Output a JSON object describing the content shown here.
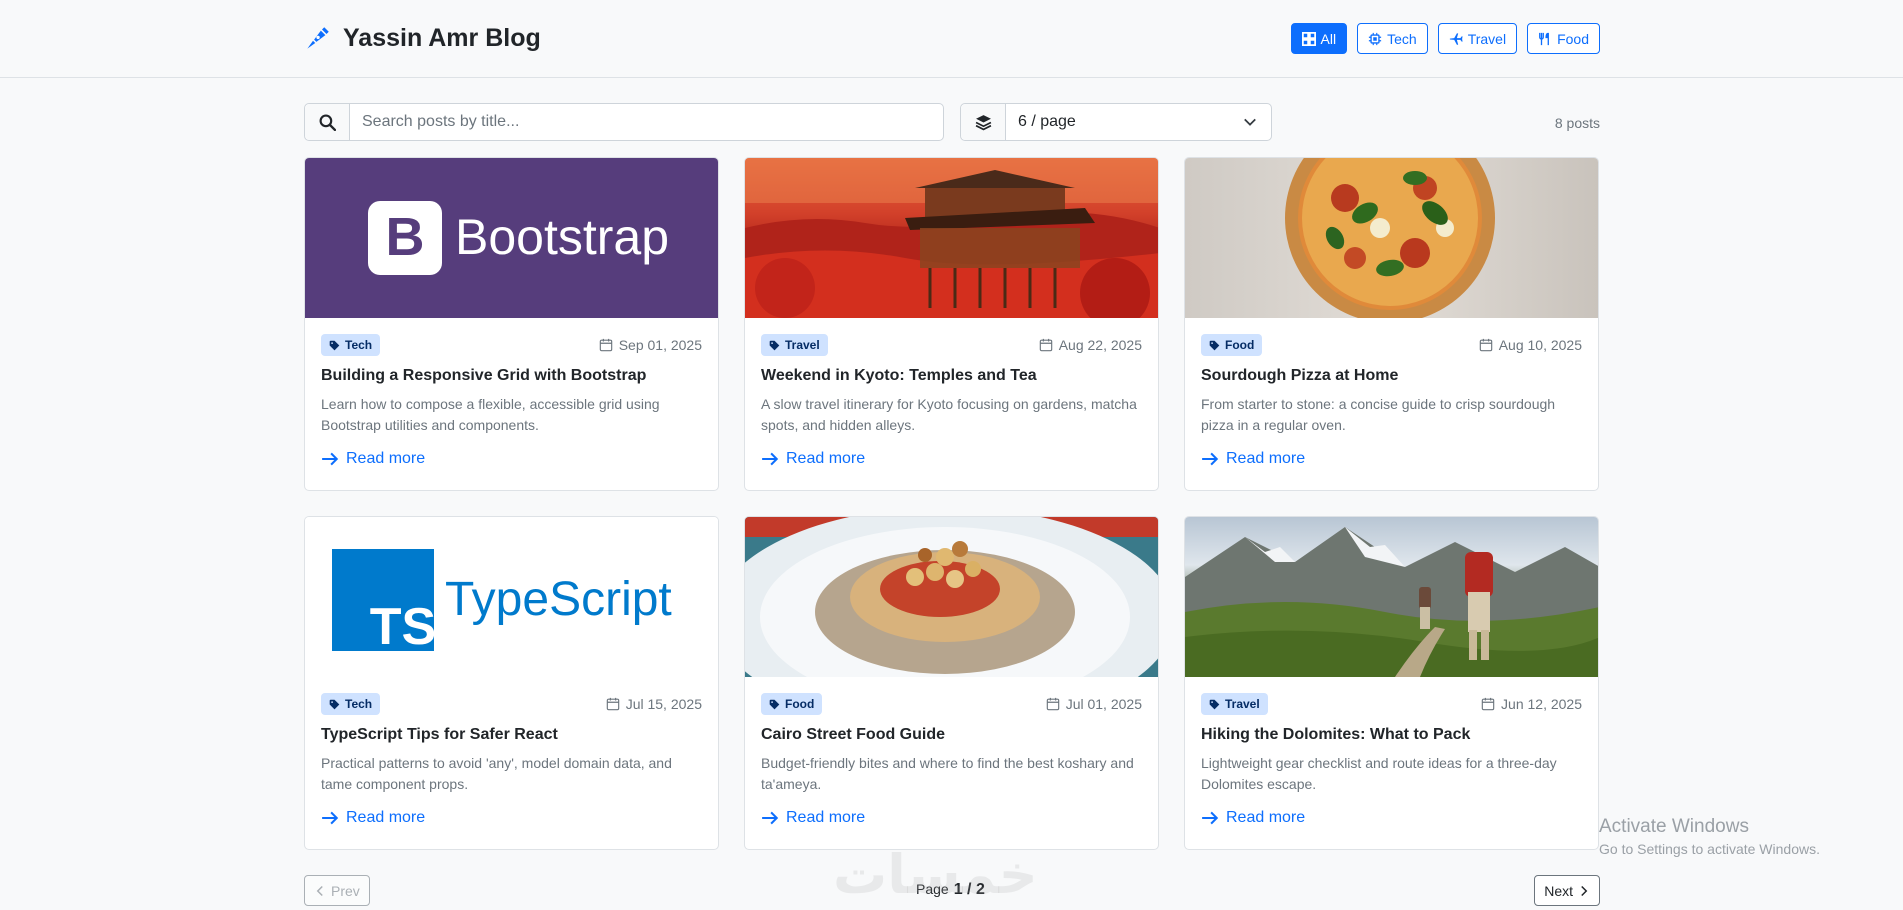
{
  "navbar": {
    "brand": "Yassin Amr Blog",
    "filters": [
      {
        "label": "All",
        "active": true
      },
      {
        "label": "Tech",
        "active": false
      },
      {
        "label": "Travel",
        "active": false
      },
      {
        "label": "Food",
        "active": false
      }
    ]
  },
  "toolbar": {
    "search_placeholder": "Search posts by title...",
    "page_size": "6 / page",
    "post_count": "8 posts"
  },
  "posts": [
    {
      "category": "Tech",
      "date": "Sep 01, 2025",
      "title": "Building a Responsive Grid with Bootstrap",
      "excerpt": "Learn how to compose a flexible, accessible grid using Bootstrap utilities and components.",
      "link": "Read more",
      "image_text": "Bootstrap",
      "image_mark": "B"
    },
    {
      "category": "Travel",
      "date": "Aug 22, 2025",
      "title": "Weekend in Kyoto: Temples and Tea",
      "excerpt": "A slow travel itinerary for Kyoto focusing on gardens, matcha spots, and hidden alleys.",
      "link": "Read more"
    },
    {
      "category": "Food",
      "date": "Aug 10, 2025",
      "title": "Sourdough Pizza at Home",
      "excerpt": "From starter to stone: a concise guide to crisp sourdough pizza in a regular oven.",
      "link": "Read more"
    },
    {
      "category": "Tech",
      "date": "Jul 15, 2025",
      "title": "TypeScript Tips for Safer React",
      "excerpt": "Practical patterns to avoid 'any', model domain data, and tame component props.",
      "link": "Read more",
      "image_text": "TypeScript",
      "image_mark": "TS"
    },
    {
      "category": "Food",
      "date": "Jul 01, 2025",
      "title": "Cairo Street Food Guide",
      "excerpt": "Budget-friendly bites and where to find the best koshary and ta'ameya.",
      "link": "Read more"
    },
    {
      "category": "Travel",
      "date": "Jun 12, 2025",
      "title": "Hiking the Dolomites: What to Pack",
      "excerpt": "Lightweight gear checklist and route ideas for a three-day Dolomites escape.",
      "link": "Read more"
    }
  ],
  "pagination": {
    "prev": "Prev",
    "next": "Next",
    "page_label": "Page",
    "current": "1 / 2"
  },
  "os_overlay": {
    "title": "Activate Windows",
    "subtitle": "Go to Settings to activate Windows."
  },
  "watermark": "خمسات",
  "colors": {
    "primary": "#0d6efd",
    "bootstrap_purple": "#563d7c",
    "typescript_blue": "#007acc",
    "badge_bg": "#cfe2ff"
  }
}
